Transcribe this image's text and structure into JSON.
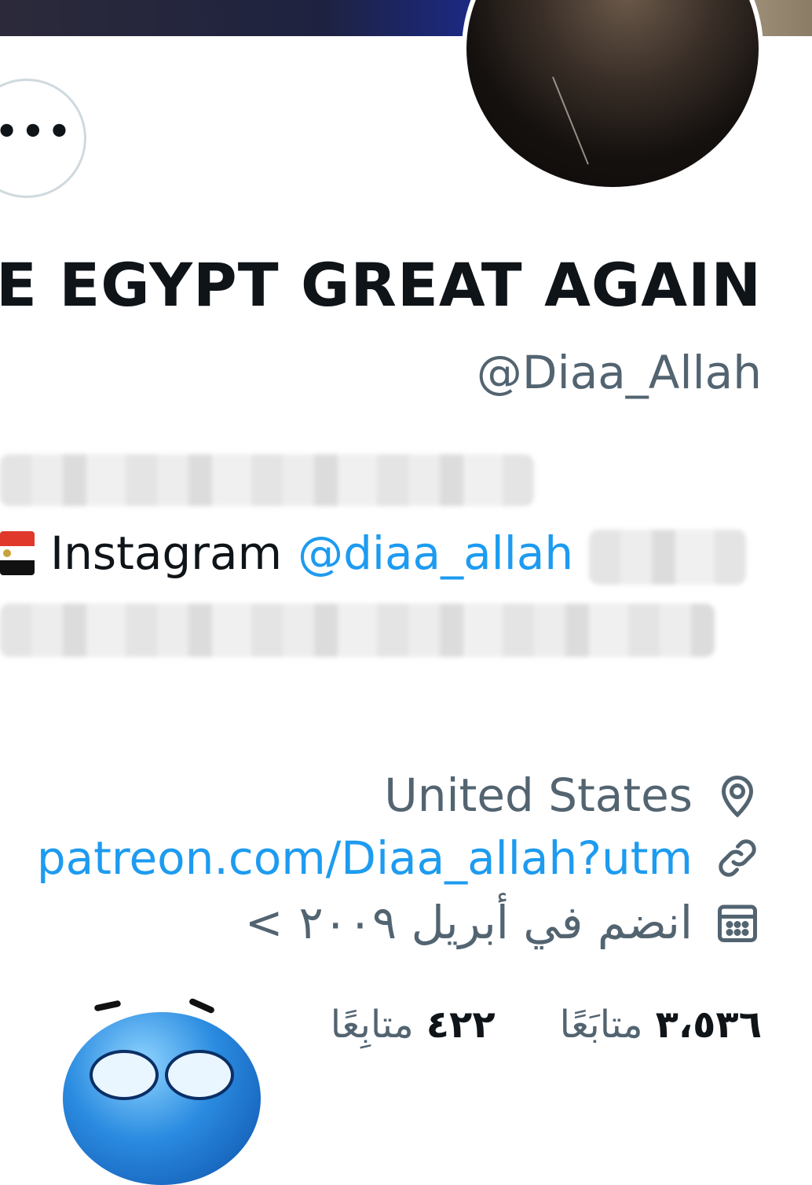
{
  "profile": {
    "display_name": "E EGYPT GREAT AGAIN",
    "handle": "@Diaa_Allah"
  },
  "bio": {
    "instagram_label": "Instagram",
    "instagram_mention": "@diaa_allah",
    "flag_icon": "egypt-flag-icon"
  },
  "toolbar": {
    "more_label": "•••"
  },
  "meta": {
    "location": "United States",
    "website": "patreon.com/Diaa_allah?utm",
    "joined": "انضم في أبريل ٢٠٠٩",
    "joined_chevron": "<",
    "icons": {
      "location": "location-pin-icon",
      "website": "link-icon",
      "joined": "calendar-icon"
    }
  },
  "stats": {
    "following_count": "٣،٥٣٦",
    "following_label": "متابَعًا",
    "followers_count": "٤٢٢",
    "followers_label": "متابِعًا"
  },
  "colors": {
    "accent": "#1d9bf0",
    "secondary_text": "#536471",
    "primary_text": "#0f1419",
    "border": "#cfd9de"
  }
}
